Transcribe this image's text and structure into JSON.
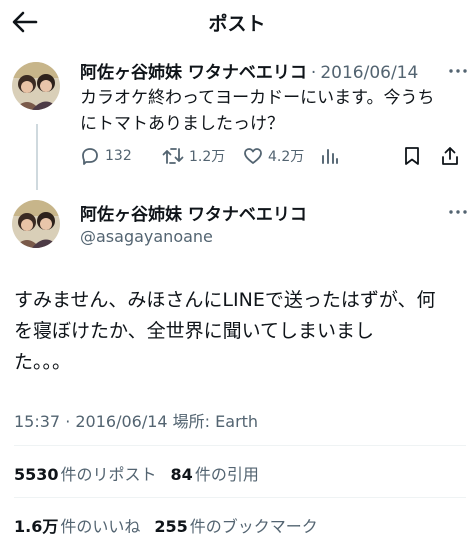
{
  "header": {
    "title": "ポスト"
  },
  "parent_post": {
    "display_name": "阿佐ヶ谷姉妹 ワタナベエリコ",
    "separator": "·",
    "date": "2016/06/14",
    "text_line1": "カラオケ終わってヨーカドーにいます。今うち",
    "text_line2": "にトマトありましたっけ？",
    "replies": "132",
    "reposts": "1.2万",
    "likes": "4.2万"
  },
  "main_post": {
    "display_name": "阿佐ヶ谷姉妹 ワタナベエリコ",
    "handle": "@asagayanoane",
    "text_line1": "すみません、みほさんにLINEで送ったはずが、何",
    "text_line2": "を寝ぼけたか、全世界に聞いてしまいまし",
    "text_line3": "た。。。",
    "meta": "15:37 · 2016/06/14 場所: ",
    "place": "Earth"
  },
  "stats": {
    "reposts_count": "5530",
    "reposts_label": "件のリポスト",
    "quotes_count": "84",
    "quotes_label": "件の引用",
    "likes_count": "1.6万",
    "likes_label": "件のいいね",
    "bookmarks_count": "255",
    "bookmarks_label": "件のブックマーク"
  },
  "colors": {
    "text": "#0f1419",
    "muted": "#536471",
    "divider": "#eff3f4",
    "thread": "#cfd9de"
  },
  "icons": [
    "back-arrow-icon",
    "more-icon",
    "reply-icon",
    "repost-icon",
    "like-icon",
    "views-icon",
    "bookmark-icon",
    "share-icon"
  ]
}
